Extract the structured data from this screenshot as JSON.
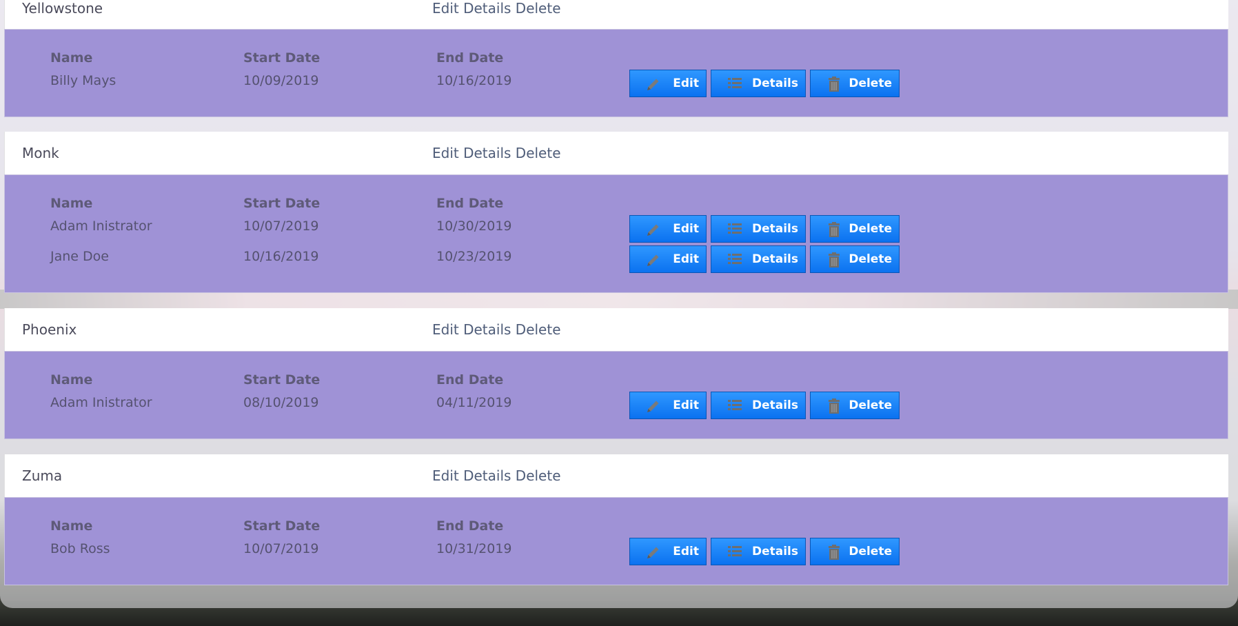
{
  "links": {
    "edit": "Edit",
    "details": "Details",
    "delete": "Delete"
  },
  "columns": {
    "name": "Name",
    "start": "Start Date",
    "end": "End Date"
  },
  "buttons": {
    "edit": "Edit",
    "details": "Details",
    "delete": "Delete"
  },
  "icons": {
    "edit": "pencil-icon",
    "details": "list-icon",
    "delete": "trash-icon"
  },
  "colors": {
    "row_bg": "#9f92d6",
    "button": "#1a82f7",
    "header_bg": "#ffffff"
  },
  "parks": [
    {
      "name": "Yellowstone",
      "bookings": [
        {
          "name": "Billy Mays",
          "start": "10/09/2019",
          "end": "10/16/2019"
        }
      ]
    },
    {
      "name": "Monk",
      "bookings": [
        {
          "name": "Adam Inistrator",
          "start": "10/07/2019",
          "end": "10/30/2019"
        },
        {
          "name": "Jane Doe",
          "start": "10/16/2019",
          "end": "10/23/2019"
        }
      ]
    },
    {
      "name": "Phoenix",
      "bookings": [
        {
          "name": "Adam Inistrator",
          "start": "08/10/2019",
          "end": "04/11/2019"
        }
      ]
    },
    {
      "name": "Zuma",
      "bookings": [
        {
          "name": "Bob Ross",
          "start": "10/07/2019",
          "end": "10/31/2019"
        }
      ]
    }
  ]
}
